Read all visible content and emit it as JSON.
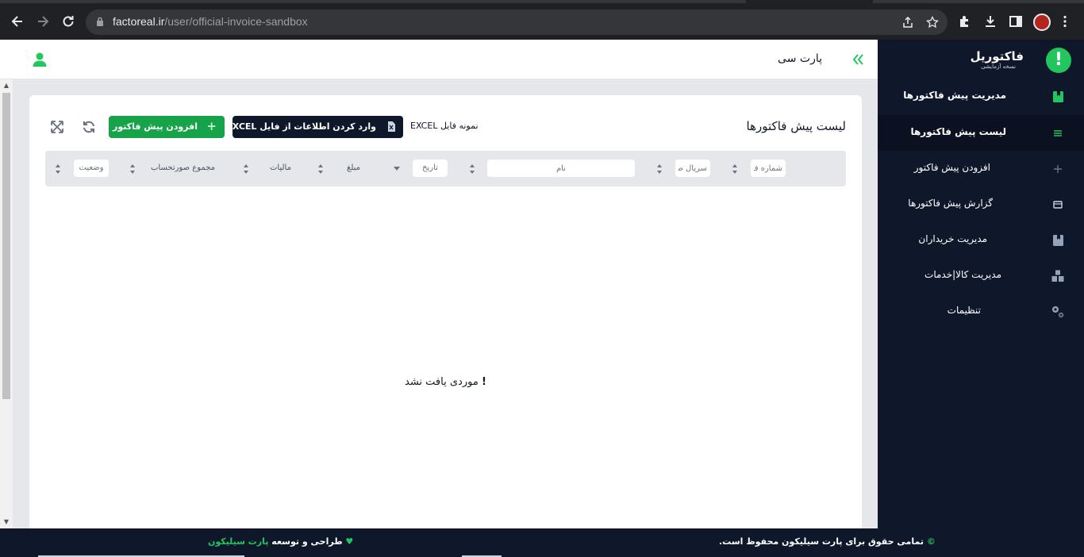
{
  "browser": {
    "url_host": "factoreal.ir",
    "url_path": "/user/official-invoice-sandbox"
  },
  "sidebar": {
    "brand_name": "فاکتوریل",
    "brand_version": "نسخه آزمایشی",
    "items": [
      {
        "label": "مدیریت پیش فاکتورها",
        "icon": "bookmark-icon"
      },
      {
        "label": "لیست پیش فاکتورها",
        "icon": "list-icon"
      },
      {
        "label": "افزودن پیش فاکتور",
        "icon": "plus-icon"
      },
      {
        "label": "گزارش پیش فاکتورها",
        "icon": "report-icon"
      },
      {
        "label": "مدیریت خریداران",
        "icon": "bookmark-icon"
      },
      {
        "label": "مدیریت کالا|خدمات",
        "icon": "boxes-icon"
      },
      {
        "label": "تنظیمات",
        "icon": "gears-icon"
      }
    ]
  },
  "header": {
    "title": "پارت سی"
  },
  "card": {
    "title": "لیست پیش فاکتورها",
    "import_excel_label": "وارد کردن اطلاعات از فایل EXCEL",
    "sample_file_label": "نمونه فایل EXCEL",
    "add_invoice_label": "افزودن پیش فاکتور"
  },
  "filters": {
    "invoice_number_placeholder": "شماره فاکتور",
    "serial_placeholder": "سریال صورتحساب",
    "name_placeholder": "نام",
    "date_value": "تاریخ",
    "amount_label": "مبلغ",
    "tax_label": "مالیات",
    "total_label": "مجموع صورتحساب",
    "status_value": "وضعیت"
  },
  "empty_state": {
    "message": "موردی یافت نشد",
    "mark": "!"
  },
  "footer": {
    "copyright_text": "تمامی حقوق برای پارت سیلیکون محفوظ است.",
    "copyright_symbol": "©",
    "design_prefix": "طراحی و توسعه",
    "design_company": "پارت سیلیکون",
    "heart_symbol": "♥"
  },
  "colors": {
    "sidebar_bg": "#0f172a",
    "accent_green": "#16a34a",
    "brand_green": "#22c55e"
  }
}
